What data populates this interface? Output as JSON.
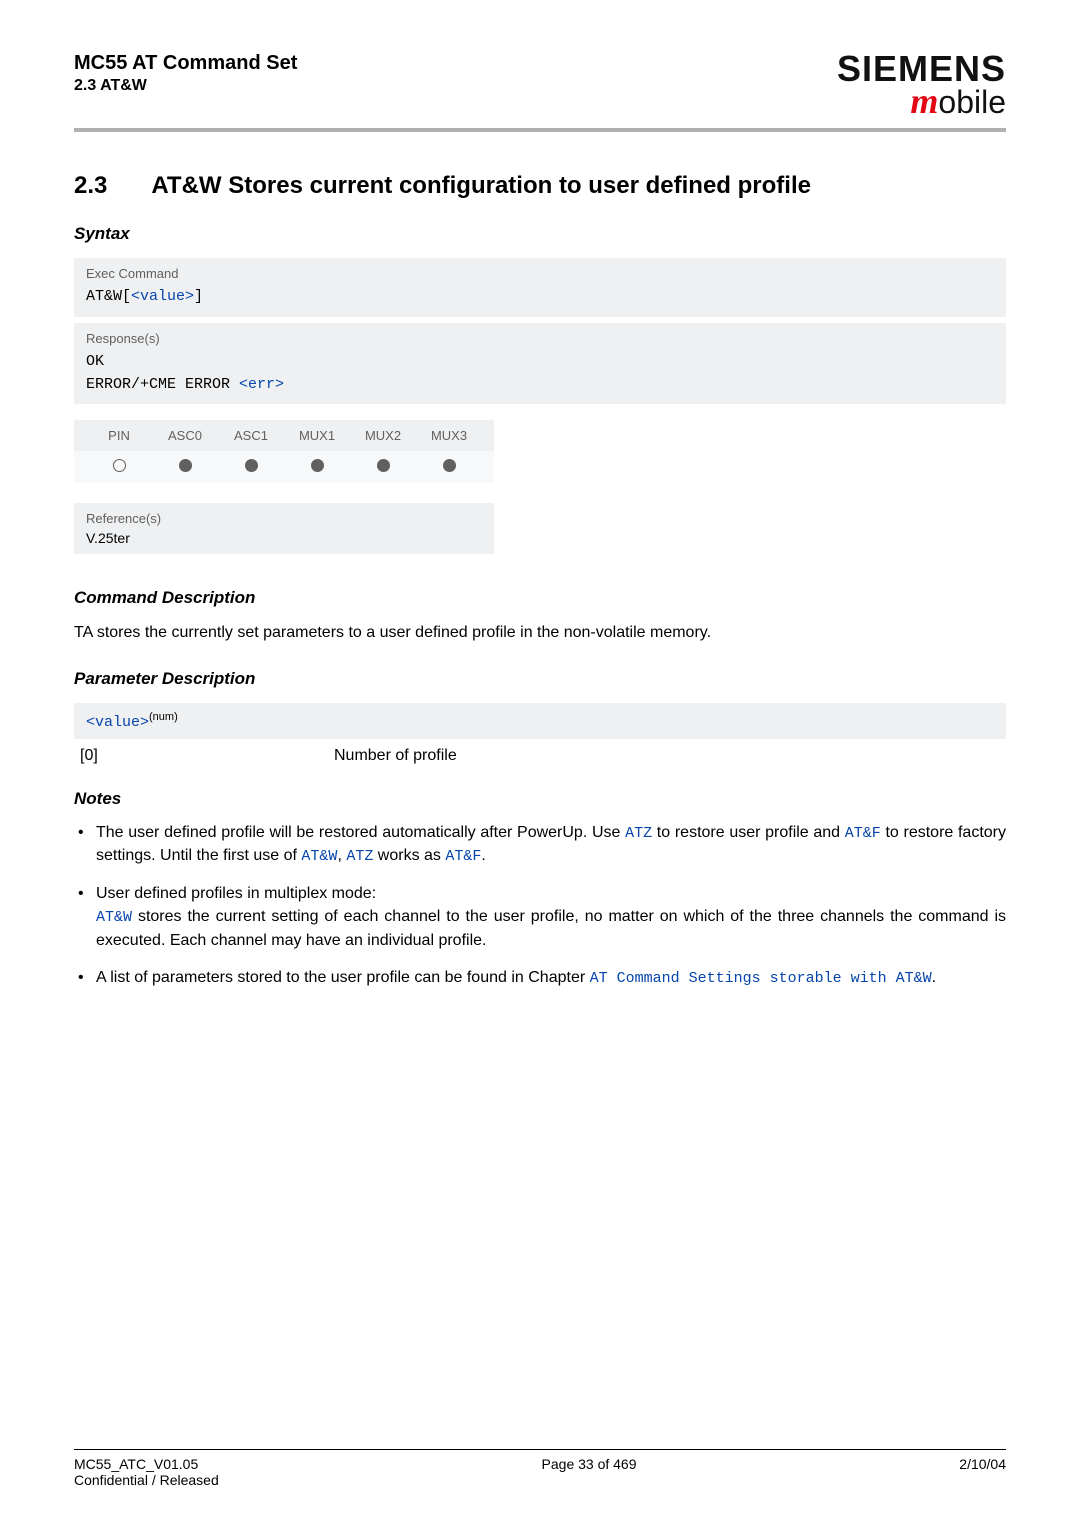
{
  "header": {
    "title": "MC55 AT Command Set",
    "section_ref": "2.3 AT&W",
    "brand_top": "SIEMENS",
    "brand_bot_m": "m",
    "brand_bot_rest": "obile"
  },
  "section": {
    "number": "2.3",
    "title": "AT&W   Stores current configuration to user defined profile"
  },
  "syntax": {
    "heading": "Syntax",
    "exec_label": "Exec Command",
    "exec_cmd_prefix": "AT&W",
    "exec_cmd_value": "<value>",
    "resp_label": "Response(s)",
    "resp_line1": "OK",
    "resp_line2_a": "ERROR/+CME ERROR ",
    "resp_line2_b": "<err>"
  },
  "support_table": {
    "headers": [
      "PIN",
      "ASC0",
      "ASC1",
      "MUX1",
      "MUX2",
      "MUX3"
    ],
    "values": [
      "open",
      "dot",
      "dot",
      "dot",
      "dot",
      "dot"
    ]
  },
  "reference": {
    "label": "Reference(s)",
    "value": "V.25ter"
  },
  "cmd_desc": {
    "heading": "Command Description",
    "text": "TA stores the currently set parameters to a user defined profile in the non-volatile memory."
  },
  "param_desc": {
    "heading": "Parameter Description",
    "name": "<value>",
    "type": "(num)",
    "row_key": "[0]",
    "row_val": "Number of profile"
  },
  "notes": {
    "heading": "Notes",
    "n1_a": "The user defined profile will be restored automatically after PowerUp. Use ",
    "n1_atz": "ATZ",
    "n1_b": " to restore user profile and ",
    "n1_atf": "AT&F",
    "n1_c": " to restore factory settings. Until the first use of ",
    "n1_atw": "AT&W",
    "n1_d": ", ",
    "n1_atz2": "ATZ",
    "n1_e": " works as ",
    "n1_atf2": "AT&F",
    "n1_f": ".",
    "n2_line1": "User defined profiles in multiplex mode:",
    "n2_atw": "AT&W",
    "n2_rest": " stores the current setting of each channel to the user profile, no matter on which of the three channels the command is executed. Each channel may have an individual profile.",
    "n3_a": "A list of parameters stored to the user profile can be found in Chapter ",
    "n3_link": "AT Command Settings storable with AT&W",
    "n3_b": "."
  },
  "footer": {
    "left1": "MC55_ATC_V01.05",
    "left2": "Confidential / Released",
    "center": "Page 33 of 469",
    "right": "2/10/04"
  }
}
